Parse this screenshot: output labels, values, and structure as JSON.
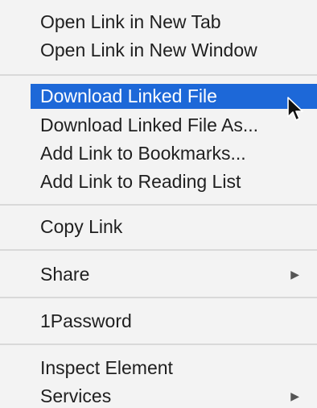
{
  "menu": {
    "items": [
      {
        "label": "Open Link in New Tab"
      },
      {
        "label": "Open Link in New Window"
      },
      {
        "label": "Download Linked File"
      },
      {
        "label": "Download Linked File As..."
      },
      {
        "label": "Add Link to Bookmarks..."
      },
      {
        "label": "Add Link to Reading List"
      },
      {
        "label": "Copy Link"
      },
      {
        "label": "Share"
      },
      {
        "label": "1Password"
      },
      {
        "label": "Inspect Element"
      },
      {
        "label": "Services"
      }
    ],
    "highlighted_item": "Download Linked File",
    "submenu_icon": "triangle-right-icon",
    "cursor_icon": "arrow-pointer-icon",
    "highlight_color": "#1d68d8"
  }
}
